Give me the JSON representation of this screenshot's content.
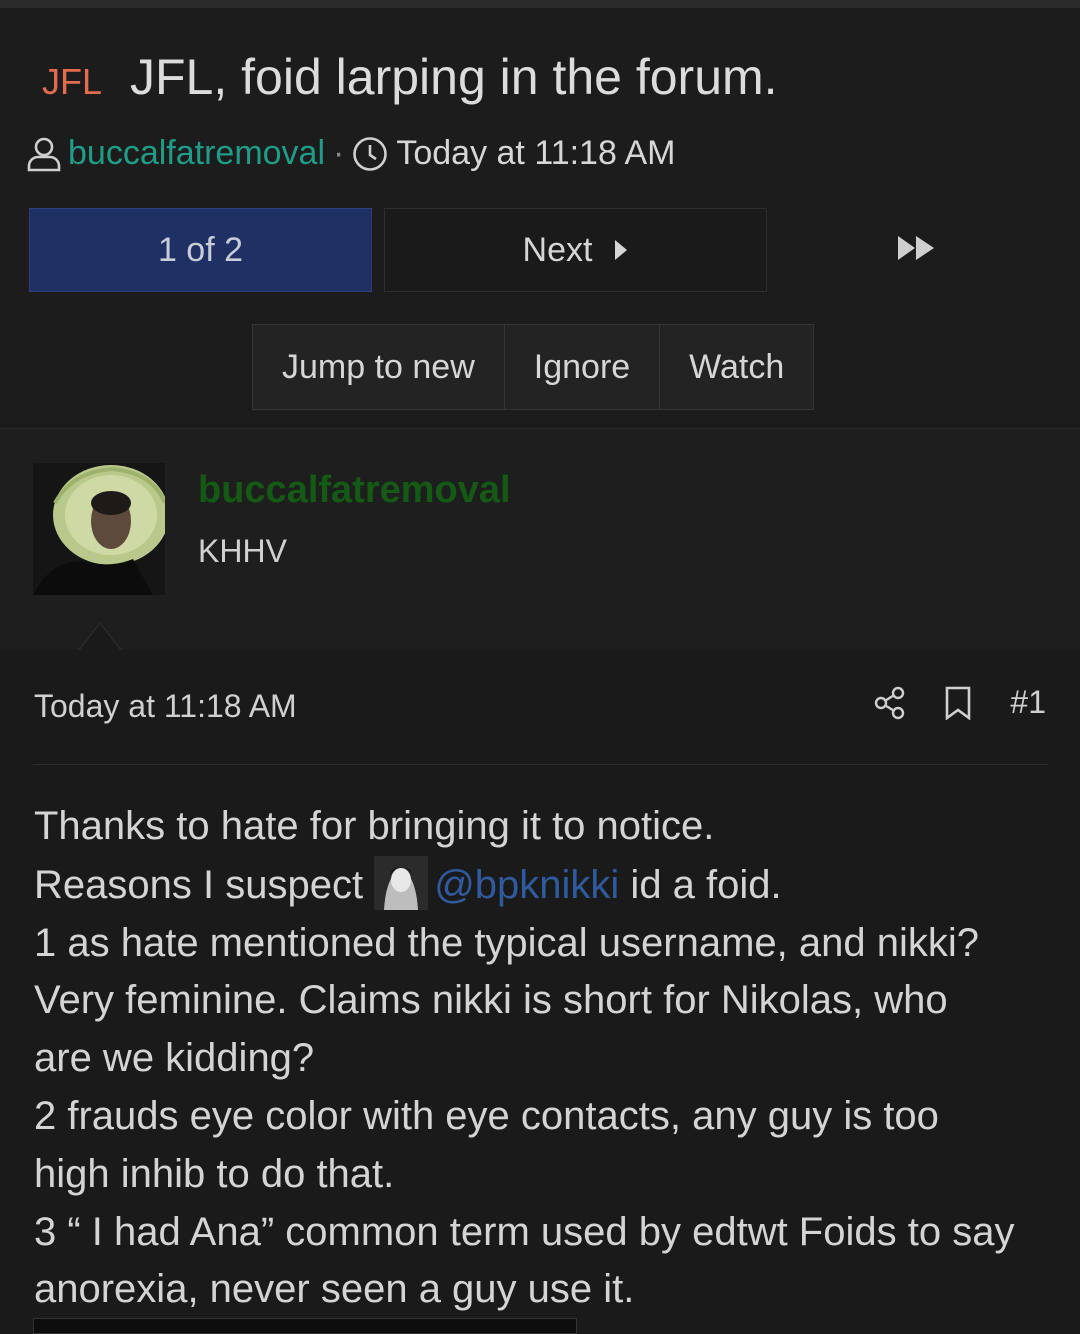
{
  "thread": {
    "prefix": "JFL",
    "title": "JFL, foid larping in the forum.",
    "author": "buccalfatremoval",
    "separator": "·",
    "time": "Today at 11:18 AM"
  },
  "pagination": {
    "current": "1 of 2",
    "next_label": "Next"
  },
  "actions": {
    "jump": "Jump to new",
    "ignore": "Ignore",
    "watch": "Watch"
  },
  "user": {
    "name": "buccalfatremoval",
    "title": "KHHV"
  },
  "post": {
    "date": "Today at 11:18 AM",
    "number": "#1",
    "line1": "Thanks to hate for bringing it to notice.",
    "line2_before": "Reasons I suspect",
    "mention": "@bpknikki",
    "line2_after": " id a foid.",
    "line3": "1 as hate mentioned the typical username, and nikki?",
    "line4": "Very feminine. Claims nikki is short for Nikolas, who",
    "line5": "are we kidding?",
    "line6": "2 frauds eye color with eye contacts, any guy is too",
    "line7": "high inhib to do that.",
    "line8": "3 “ I had Ana” common term used by edtwt Foids to say",
    "line9": "anorexia, never seen a guy use it."
  },
  "colors": {
    "prefix": "#e26c4f",
    "author_link": "#1f9c87",
    "current_page_bg": "#1f3065",
    "username_green": "#145a14",
    "mention": "#2f5a9e"
  },
  "icons": [
    "user-icon",
    "clock-icon",
    "caret-right-icon",
    "fast-forward-icon",
    "share-icon",
    "bookmark-icon"
  ]
}
